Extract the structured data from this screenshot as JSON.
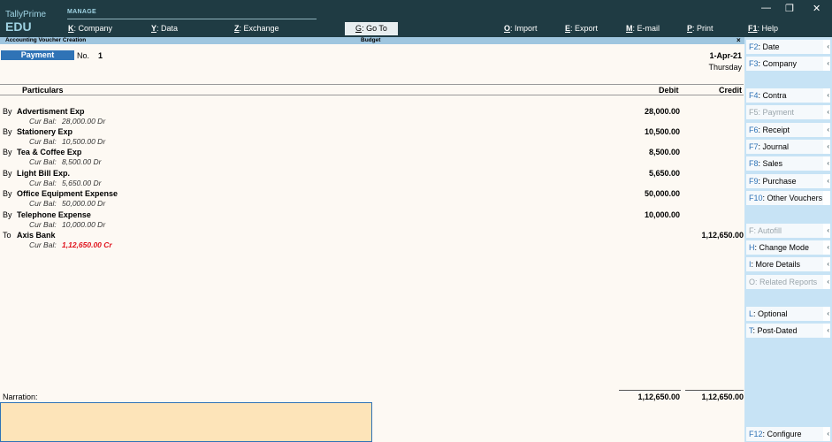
{
  "app": {
    "brand_line1": "TallyPrime",
    "brand_line2": "EDU",
    "section": "MANAGE",
    "window_controls": [
      "—",
      "❐",
      "✕"
    ]
  },
  "topmenu": [
    {
      "key": "K",
      "label": "Company"
    },
    {
      "key": "Y",
      "label": "Data"
    },
    {
      "key": "Z",
      "label": "Exchange"
    },
    {
      "key": "G",
      "label": "Go To"
    },
    {
      "key": "O",
      "label": "Import"
    },
    {
      "key": "E",
      "label": "Export"
    },
    {
      "key": "M",
      "label": "E-mail"
    },
    {
      "key": "P",
      "label": "Print"
    },
    {
      "key": "F1",
      "label": "Help"
    }
  ],
  "subbar": {
    "title": "Accounting Voucher Creation",
    "center": "Budget",
    "close": "×"
  },
  "voucher": {
    "type": "Payment",
    "no_label": "No.",
    "no": "1",
    "date": "1-Apr-21",
    "day": "Thursday"
  },
  "table": {
    "headers": {
      "particulars": "Particulars",
      "debit": "Debit",
      "credit": "Credit"
    },
    "cur_bal_label": "Cur Bal:",
    "entries": [
      {
        "drcr": "By",
        "ledger": "Advertisment Exp",
        "cur_bal": "28,000.00 Dr",
        "debit": "28,000.00",
        "credit": ""
      },
      {
        "drcr": "By",
        "ledger": "Stationery Exp",
        "cur_bal": "10,500.00 Dr",
        "debit": "10,500.00",
        "credit": ""
      },
      {
        "drcr": "By",
        "ledger": "Tea & Coffee Exp",
        "cur_bal": "8,500.00 Dr",
        "debit": "8,500.00",
        "credit": ""
      },
      {
        "drcr": "By",
        "ledger": "Light Bill Exp.",
        "cur_bal": "5,650.00 Dr",
        "debit": "5,650.00",
        "credit": ""
      },
      {
        "drcr": "By",
        "ledger": "Office Equipment Expense",
        "cur_bal": "50,000.00 Dr",
        "debit": "50,000.00",
        "credit": ""
      },
      {
        "drcr": "By",
        "ledger": "Telephone Expense",
        "cur_bal": "10,000.00 Dr",
        "debit": "10,000.00",
        "credit": ""
      },
      {
        "drcr": "To",
        "ledger": "Axis Bank",
        "cur_bal": "1,12,650.00 Cr",
        "debit": "",
        "credit": "1,12,650.00"
      }
    ],
    "total_debit": "1,12,650.00",
    "total_credit": "1,12,650.00"
  },
  "narration": {
    "label": "Narration:",
    "value": ""
  },
  "rpanel": {
    "buttons": [
      {
        "key": "F2",
        "label": "Date",
        "enabled": true,
        "arrow": "‹"
      },
      {
        "key": "F3",
        "label": "Company",
        "enabled": true,
        "arrow": "‹"
      },
      {
        "key": "F4",
        "label": "Contra",
        "enabled": true,
        "arrow": "‹"
      },
      {
        "key": "F5",
        "label": "Payment",
        "enabled": false,
        "arrow": "‹"
      },
      {
        "key": "F6",
        "label": "Receipt",
        "enabled": true,
        "arrow": "‹"
      },
      {
        "key": "F7",
        "label": "Journal",
        "enabled": true,
        "arrow": "‹"
      },
      {
        "key": "F8",
        "label": "Sales",
        "enabled": true,
        "arrow": "‹"
      },
      {
        "key": "F9",
        "label": "Purchase",
        "enabled": true,
        "arrow": "‹"
      },
      {
        "key": "F10",
        "label": "Other Vouchers",
        "enabled": true,
        "arrow": ""
      },
      {
        "key": "F",
        "label": "Autofill",
        "enabled": false,
        "arrow": "‹"
      },
      {
        "key": "H",
        "label": "Change Mode",
        "enabled": true,
        "arrow": "‹"
      },
      {
        "key": "I",
        "label": "More Details",
        "enabled": true,
        "arrow": "‹"
      },
      {
        "key": "O",
        "label": "Related Reports",
        "enabled": false,
        "arrow": "‹"
      },
      {
        "key": "L",
        "label": "Optional",
        "enabled": true,
        "arrow": "‹"
      },
      {
        "key": "T",
        "label": "Post-Dated",
        "enabled": true,
        "arrow": "‹"
      },
      {
        "key": "F12",
        "label": "Configure",
        "enabled": true,
        "arrow": "‹"
      }
    ]
  },
  "colors": {
    "topbar": "#1f3b43",
    "accent": "#2f73b6",
    "panel": "#c7e3f5",
    "narration_bg": "#fde4b9",
    "negative": "#e0141e"
  }
}
